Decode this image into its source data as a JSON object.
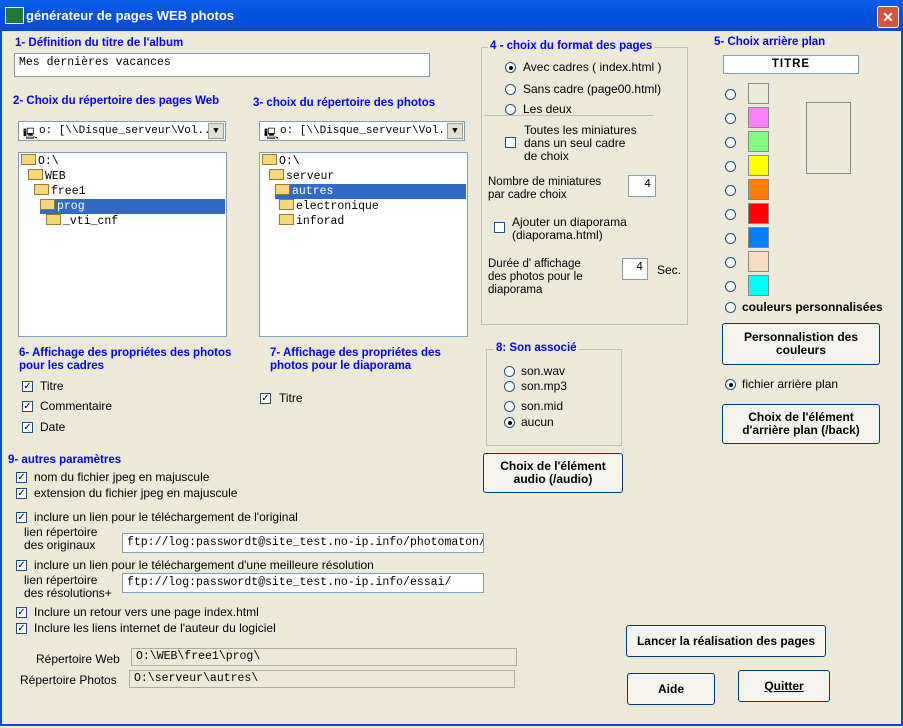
{
  "window": {
    "title": "générateur de pages WEB photos",
    "close": "✕"
  },
  "s1": {
    "heading": "1- Définition du titre de l'album",
    "value": "Mes dernières vacances"
  },
  "s2": {
    "heading": "2- Choix du répertoire des pages Web",
    "drive": "o: [\\\\Disque_serveur\\Vol...]",
    "tree": [
      "O:\\",
      "WEB",
      "free1",
      "prog",
      "_vti_cnf"
    ]
  },
  "s3": {
    "heading": "3- choix du répertoire des photos",
    "drive": "o: [\\\\Disque_serveur\\Vol...]",
    "tree": [
      "O:\\",
      "serveur",
      "autres",
      "electronique",
      "inforad"
    ]
  },
  "s4": {
    "heading": "4 - choix du format des pages",
    "opt_cadres": "Avec cadres ( index.html )",
    "opt_sans": "Sans cadre (page00.html)",
    "opt_deux": "Les deux",
    "miniatures_line1": "Toutes les miniatures",
    "miniatures_line2": "dans un seul cadre",
    "miniatures_line3": "de choix",
    "nb_label_1": "Nombre de miniatures",
    "nb_label_2": "par cadre choix",
    "nb_value": "4",
    "diapo_line1": "Ajouter un diaporama",
    "diapo_line2": "(diaporama.html)",
    "duree_1": "Durée d' affichage",
    "duree_2": "des photos   pour le",
    "duree_3": "diaporama",
    "duree_value": "4",
    "duree_unit": "Sec."
  },
  "s5": {
    "heading": "5- Choix arrière plan",
    "titre": "TITRE",
    "colors": [
      "#ece9d8",
      "#ff80ff",
      "#80ff80",
      "#ffff00",
      "#ff8000",
      "#ff0000",
      "#0080ff",
      "#f8dcc0",
      "#00ffff"
    ],
    "preview_color": "#ece9d8",
    "couleurs_perso": "couleurs   personnalisées",
    "btn_perso_1": "Personnalistion des",
    "btn_perso_2": "couleurs",
    "fichier": "fichier arrière plan",
    "btn_choix_1": "Choix de l'élément",
    "btn_choix_2": "d'arrière plan (/back)"
  },
  "s6": {
    "heading_1": "6- Affichage des propriétes des photos",
    "heading_2": "pour les cadres",
    "titre": "Titre",
    "commentaire": "Commentaire",
    "date": "Date"
  },
  "s7": {
    "heading_1": "7- Affichage des propriétes des",
    "heading_2": "photos pour le diaporama",
    "titre": "Titre"
  },
  "s8": {
    "heading": "8: Son associé",
    "wav": "son.wav",
    "mp3": "son.mp3",
    "mid": "son.mid",
    "aucun": "aucun",
    "btn_1": "Choix de l'élément",
    "btn_2": "audio (/audio)"
  },
  "s9": {
    "heading": "9- autres paramètres",
    "nom_maj": "nom du fichier jpeg en majuscule",
    "ext_maj": "extension du fichier jpeg en majuscule",
    "lien_orig": "inclure un lien pour le téléchargement de l'original",
    "lien_orig_lbl_1": "lien répertoire",
    "lien_orig_lbl_2": "des originaux",
    "lien_orig_value": "ftp://log:passwordt@site_test.no-ip.info/photomaton/",
    "lien_res": "inclure un lien pour le téléchargement   d'une meilleure résolution",
    "lien_res_lbl_1": "lien répertoire",
    "lien_res_lbl_2": "des résolutions+",
    "lien_res_value": "ftp://log:passwordt@site_test.no-ip.info/essai/",
    "retour": "Inclure un retour vers une page index.html",
    "liens_auteur": "Inclure les liens internet  de l'auteur du logiciel"
  },
  "footer": {
    "rep_web_lbl": "Répertoire Web",
    "rep_web_value": "O:\\WEB\\free1\\prog\\",
    "rep_photos_lbl": "Répertoire Photos",
    "rep_photos_value": "O:\\serveur\\autres\\",
    "lancer": "Lancer la réalisation  des pages",
    "aide": "Aide",
    "quitter": "Quitter"
  }
}
